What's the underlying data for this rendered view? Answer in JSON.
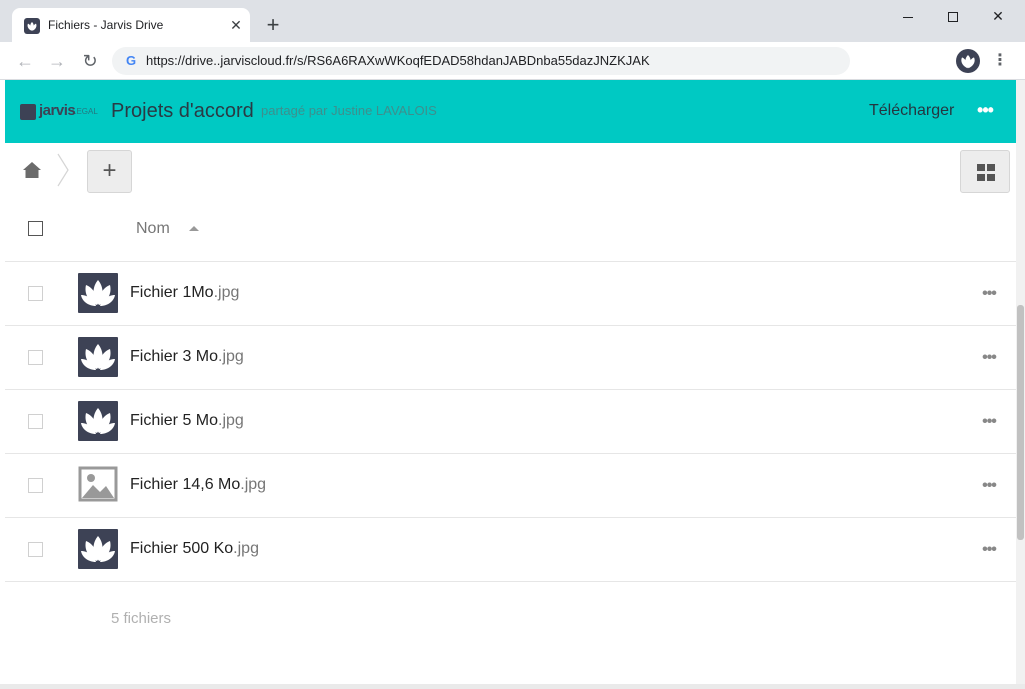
{
  "browser": {
    "tab_title": "Fichiers - Jarvis Drive",
    "tab_close": "✕",
    "new_tab": "+",
    "url": "https://drive..jarviscloud.fr/s/RS6A6RAXwWKoqfEDAD58hdanJABDnba55dazJNZKJAK",
    "back_icon": "←",
    "forward_icon": "→",
    "reload_icon": "↻",
    "menu_icon": "⋮"
  },
  "header": {
    "logo_text": "jarvis",
    "logo_sub": "LEGAL",
    "folder_title": "Projets d'accord",
    "shared_by": "partagé par Justine LAVALOIS",
    "download_label": "Télécharger",
    "more_icon": "•••",
    "accent_color": "#00c9c3"
  },
  "controls": {
    "add_label": "+"
  },
  "list": {
    "column_name": "Nom",
    "rows": [
      {
        "name": "Fichier 1Mo",
        "ext": ".jpg",
        "thumb": "jarvis-logo"
      },
      {
        "name": "Fichier 3 Mo",
        "ext": ".jpg",
        "thumb": "jarvis-logo"
      },
      {
        "name": "Fichier 5 Mo",
        "ext": ".jpg",
        "thumb": "jarvis-logo"
      },
      {
        "name": "Fichier 14,6 Mo",
        "ext": ".jpg",
        "thumb": "image-placeholder"
      },
      {
        "name": "Fichier 500 Ko",
        "ext": ".jpg",
        "thumb": "jarvis-logo"
      }
    ],
    "row_more_icon": "•••",
    "summary": "5 fichiers"
  }
}
